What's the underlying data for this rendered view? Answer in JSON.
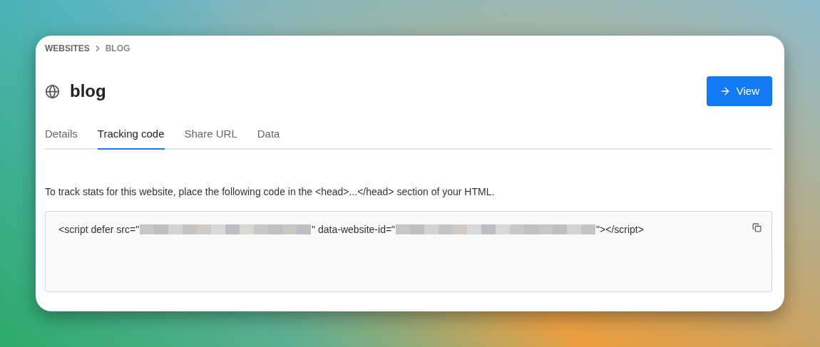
{
  "breadcrumb": [
    {
      "label": "WEBSITES"
    },
    {
      "label": "BLOG"
    }
  ],
  "title": "blog",
  "view_button": {
    "label": "View"
  },
  "tabs": [
    {
      "label": "Details",
      "selected": false
    },
    {
      "label": "Tracking code",
      "selected": true
    },
    {
      "label": "Share URL",
      "selected": false
    },
    {
      "label": "Data",
      "selected": false
    }
  ],
  "description": "To track stats for this website, place the following code in the <head>...</head> section of your HTML.",
  "code": [
    {
      "kind": "text",
      "text": "<script defer src=\""
    },
    {
      "kind": "redacted"
    },
    {
      "kind": "text",
      "text": "\" data-website-id=\""
    },
    {
      "kind": "redacted"
    },
    {
      "kind": "text",
      "text": "\"></script>"
    }
  ]
}
